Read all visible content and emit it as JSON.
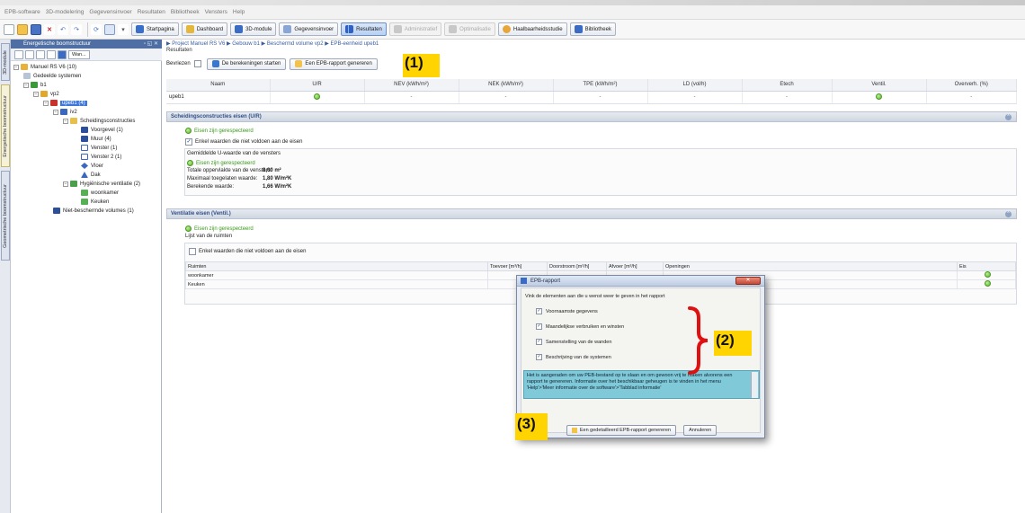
{
  "menu": [
    "EPB-software",
    "3D-modelering",
    "Gegevensinvoer",
    "Resultaten",
    "Bibliotheek",
    "Vensters",
    "Help"
  ],
  "toolbar": {
    "startpagina": "Startpagina",
    "dashboard": "Dashboard",
    "module3d": "3D-module",
    "gegevensinvoer": "Gegevensinvoer",
    "resultaten": "Resultaten",
    "administratief": "Administratief",
    "optimalisatie": "Optimalisatie",
    "haalbaarheidsstudie": "Haalbaarheidsstudie",
    "bibliotheek": "Bibliotheek"
  },
  "sidetabs": [
    "3D-module",
    "Energetische boomstructuur",
    "Geometrische boomstructuur"
  ],
  "tree": {
    "header": "Energetische boomstructuur",
    "wan_label": "Wan...",
    "nodes": {
      "root": "Manuel RS V6 (10)",
      "gedeelde": "Gedeelde systemen",
      "b1": "b1",
      "vp2": "vp2",
      "upeb1": "upeb1 (4)",
      "iv2": "iv2",
      "scheiding": "Scheidingsconstructies",
      "voorgevel": "Voorgevel (1)",
      "muur": "Muur (4)",
      "venster": "Venster (1)",
      "venster2": "Venster 2 (1)",
      "vloer": "Vloer",
      "dak": "Dak",
      "hygienische": "Hygiënische ventilatie (2)",
      "woonkamer": "woonkamer",
      "keuken": "Keuken",
      "niet_beschermde": "Niet-beschermde volumes (1)"
    }
  },
  "main": {
    "breadcrumb": "▶ Project Manuel RS V6 ▶ Gebouw b1 ▶ Beschermd volume vp2 ▶ EPB-eenheid upeb1",
    "page_title": "Resultaten",
    "bevriezen": "Bevriezen",
    "start_button": "De berekeningen starten",
    "generate_button": "Een EPB-rapport genereren",
    "results_headers": [
      "Naam",
      "U/R",
      "NEV (kWh/m²)",
      "NEK (kWh/m²)",
      "TPE (kWh/m²)",
      "LD (vol/h)",
      "Etech",
      "Ventil.",
      "Oververh. (%)"
    ],
    "results_row": {
      "naam": "upeb1",
      "nev": "-",
      "nek": "-",
      "tpe": "-",
      "ld": "-",
      "etech": "-",
      "oververh": "-"
    },
    "sections": {
      "ur": {
        "title": "Scheidingsconstructies eisen (U/R)",
        "status": "Eisen zijn gerespecteerd",
        "filter": "Enkel waarden die niet voldoen aan de eisen",
        "avg_title": "Gemiddelde U-waarde van de vensters",
        "avg_status": "Eisen zijn gerespecteerd",
        "rows": [
          {
            "label": "Totale oppervlakte van de vensters:",
            "value": "8,00 m²"
          },
          {
            "label": "Maximaal toegelaten waarde:",
            "value": "1,80 W/m²K"
          },
          {
            "label": "Berekende waarde:",
            "value": "1,66 W/m²K"
          }
        ]
      },
      "vent": {
        "title": "Ventilatie eisen (Ventil.)",
        "status": "Eisen zijn gerespecteerd",
        "list_title": "Lijst van de ruimten",
        "filter": "Enkel waarden die niet voldoen aan de eisen",
        "headers": [
          "Ruimten",
          "Toevoer [m³/h]",
          "Doorstroom [m³/h]",
          "Afvoer [m³/h]",
          "Openingen",
          "Eis"
        ],
        "rooms": [
          "woonkamer",
          "Keuken"
        ]
      }
    }
  },
  "dialog": {
    "title": "EPB-rapport",
    "instruction": "Vink de elementen aan die u wenst weer te geven in het rapport",
    "items": [
      "Voornaamste gegevens",
      "Maandelijkse verbruiken en winsten",
      "Samenstelling van de wanden",
      "Beschrijving van de systemen"
    ],
    "info": "Het is aangeraden om uw PEB-bestand op te slaan en om gewoon vrij te maken alvorens een rapport te genereren. Informatie over het beschikbaar geheugen is te vinden in het menu 'Help'>'Meer informatie over de software'>'Tabblad informatie'",
    "generate": "Een gedetailleerd EPB-rapport genereren",
    "cancel": "Annuleren"
  },
  "callouts": [
    "(1)",
    "(2)",
    "(3)"
  ],
  "colors": {
    "accent": "#3d78d8",
    "ok_green": "#5db32d",
    "highlight": "#ffd400",
    "callout_bracket": "#e01010"
  }
}
